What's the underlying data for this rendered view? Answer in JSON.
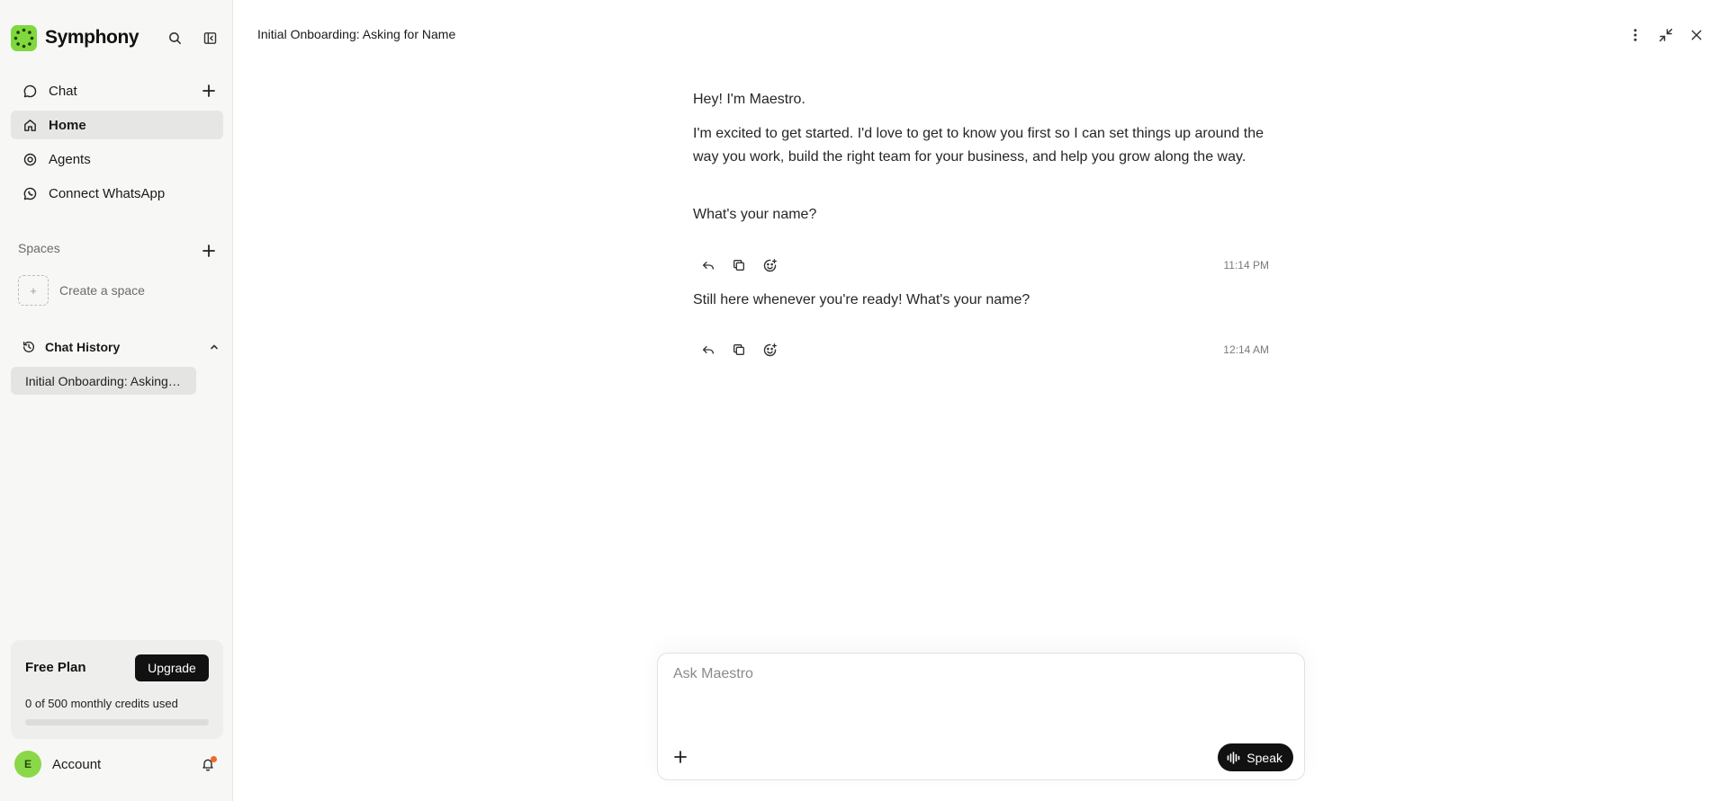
{
  "brand": {
    "name": "Symphony",
    "color": "#7fd83d"
  },
  "nav": {
    "items": [
      {
        "label": "Chat",
        "icon": "chat-bubble-icon"
      },
      {
        "label": "Home",
        "icon": "home-icon"
      },
      {
        "label": "Agents",
        "icon": "target-icon"
      },
      {
        "label": "Connect WhatsApp",
        "icon": "whatsapp-icon"
      }
    ],
    "active": "Home"
  },
  "spaces": {
    "label": "Spaces",
    "create_label": "Create a space"
  },
  "history": {
    "label": "Chat History",
    "items": [
      "Initial Onboarding: Asking for Name"
    ]
  },
  "plan": {
    "title": "Free Plan",
    "upgrade_label": "Upgrade",
    "credits_text": "0 of 500 monthly credits used",
    "credits_used": 0,
    "credits_total": 500
  },
  "account": {
    "initial": "E",
    "label": "Account"
  },
  "header": {
    "title": "Initial Onboarding: Asking for Name"
  },
  "messages": [
    {
      "paragraphs": [
        "Hey! I'm Maestro.",
        "I'm excited to get started. I'd love to get to know you first so I can set things up around the way you work, build the right team for your business, and help you grow along the way.",
        "What's your name?"
      ],
      "time": "11:14 PM"
    },
    {
      "paragraphs": [
        "Still here whenever you're ready! What's your name?"
      ],
      "time": "12:14 AM"
    }
  ],
  "composer": {
    "placeholder": "Ask Maestro",
    "value": "",
    "speak_label": "Speak"
  }
}
